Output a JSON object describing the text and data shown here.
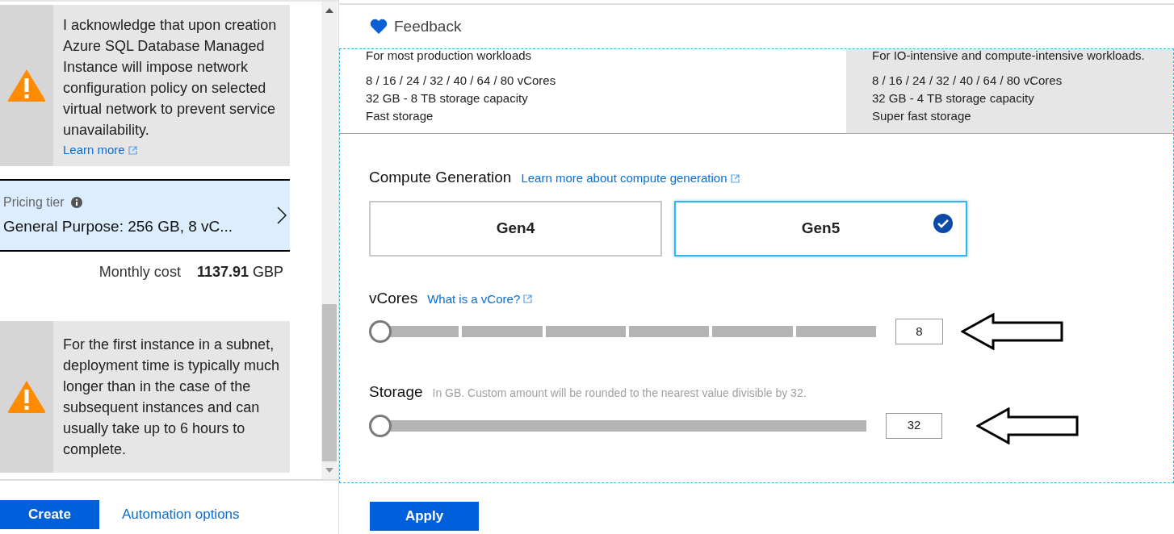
{
  "left_panel": {
    "notices": [
      {
        "text": "I acknowledge that upon creation Azure SQL Database Managed Instance will impose network configuration policy on selected virtual network to prevent service unavailability.",
        "link": "Learn more"
      },
      {
        "text": "For the first instance in a subnet, deployment time is typically much longer than in the case of the subsequent instances and can usually take up to 6 hours to complete."
      }
    ],
    "pricing_tier": {
      "label": "Pricing tier",
      "value": "General Purpose: 256 GB, 8 vC..."
    },
    "monthly_cost": {
      "label": "Monthly cost",
      "amount": "1137.91",
      "currency": "GBP"
    },
    "buttons": {
      "create": "Create",
      "automation": "Automation options"
    }
  },
  "right_panel": {
    "feedback": "Feedback",
    "tiers": [
      {
        "description": "For most production workloads",
        "lines": [
          "8 / 16 / 24 / 32 / 40 / 64 / 80 vCores",
          "32 GB - 8 TB storage capacity",
          "Fast storage"
        ],
        "selected": true
      },
      {
        "description": "For IO-intensive and compute-intensive workloads.",
        "lines": [
          "8 / 16 / 24 / 32 / 40 / 64 / 80 vCores",
          "32 GB - 4 TB storage capacity",
          "Super fast storage"
        ],
        "selected": false
      }
    ],
    "compute_generation": {
      "title": "Compute Generation",
      "link": "Learn more about compute generation",
      "options": [
        {
          "label": "Gen4",
          "selected": false
        },
        {
          "label": "Gen5",
          "selected": true
        }
      ]
    },
    "sliders": [
      {
        "kind": "segmented",
        "title": "vCores",
        "link": "What is a vCore?",
        "level": 0,
        "value": "8"
      },
      {
        "kind": "plain",
        "title": "Storage",
        "hint": "In GB. Custom amount will be rounded to the nearest value divisible by 32.",
        "level": 0,
        "value": "32"
      }
    ],
    "apply": "Apply"
  }
}
